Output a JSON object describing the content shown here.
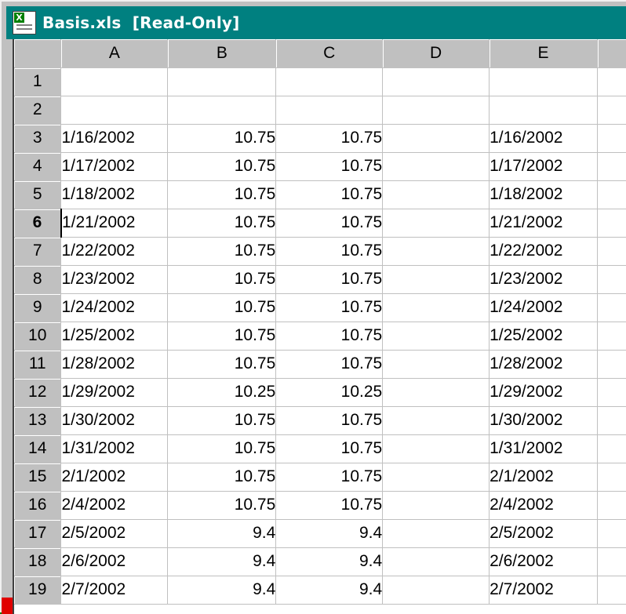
{
  "window": {
    "title": "Basis.xls  [Read-Only]"
  },
  "columns": [
    "A",
    "B",
    "C",
    "D",
    "E"
  ],
  "rows": [
    {
      "num": "1",
      "a": "",
      "b": "",
      "c": "",
      "d": "",
      "e": ""
    },
    {
      "num": "2",
      "a": "",
      "b": "",
      "c": "",
      "d": "",
      "e": ""
    },
    {
      "num": "3",
      "a": "1/16/2002",
      "b": "10.75",
      "c": "10.75",
      "d": "",
      "e": "1/16/2002"
    },
    {
      "num": "4",
      "a": "1/17/2002",
      "b": "10.75",
      "c": "10.75",
      "d": "",
      "e": "1/17/2002"
    },
    {
      "num": "5",
      "a": "1/18/2002",
      "b": "10.75",
      "c": "10.75",
      "d": "",
      "e": "1/18/2002"
    },
    {
      "num": "6",
      "a": "1/21/2002",
      "b": "10.75",
      "c": "10.75",
      "d": "",
      "e": "1/21/2002"
    },
    {
      "num": "7",
      "a": "1/22/2002",
      "b": "10.75",
      "c": "10.75",
      "d": "",
      "e": "1/22/2002"
    },
    {
      "num": "8",
      "a": "1/23/2002",
      "b": "10.75",
      "c": "10.75",
      "d": "",
      "e": "1/23/2002"
    },
    {
      "num": "9",
      "a": "1/24/2002",
      "b": "10.75",
      "c": "10.75",
      "d": "",
      "e": "1/24/2002"
    },
    {
      "num": "10",
      "a": "1/25/2002",
      "b": "10.75",
      "c": "10.75",
      "d": "",
      "e": "1/25/2002"
    },
    {
      "num": "11",
      "a": "1/28/2002",
      "b": "10.75",
      "c": "10.75",
      "d": "",
      "e": "1/28/2002"
    },
    {
      "num": "12",
      "a": "1/29/2002",
      "b": "10.25",
      "c": "10.25",
      "d": "",
      "e": "1/29/2002"
    },
    {
      "num": "13",
      "a": "1/30/2002",
      "b": "10.75",
      "c": "10.75",
      "d": "",
      "e": "1/30/2002"
    },
    {
      "num": "14",
      "a": "1/31/2002",
      "b": "10.75",
      "c": "10.75",
      "d": "",
      "e": "1/31/2002"
    },
    {
      "num": "15",
      "a": "2/1/2002",
      "b": "10.75",
      "c": "10.75",
      "d": "",
      "e": "2/1/2002"
    },
    {
      "num": "16",
      "a": "2/4/2002",
      "b": "10.75",
      "c": "10.75",
      "d": "",
      "e": "2/4/2002"
    },
    {
      "num": "17",
      "a": "2/5/2002",
      "b": "9.4",
      "c": "9.4",
      "d": "",
      "e": "2/5/2002"
    },
    {
      "num": "18",
      "a": "2/6/2002",
      "b": "9.4",
      "c": "9.4",
      "d": "",
      "e": "2/6/2002"
    },
    {
      "num": "19",
      "a": "2/7/2002",
      "b": "9.4",
      "c": "9.4",
      "d": "",
      "e": "2/7/2002"
    }
  ],
  "active_row": "6",
  "colors": {
    "title_bar": "#008080",
    "chrome": "#c0c0c0",
    "desktop": "#008000"
  },
  "icons": {
    "window": "excel-document-icon"
  }
}
